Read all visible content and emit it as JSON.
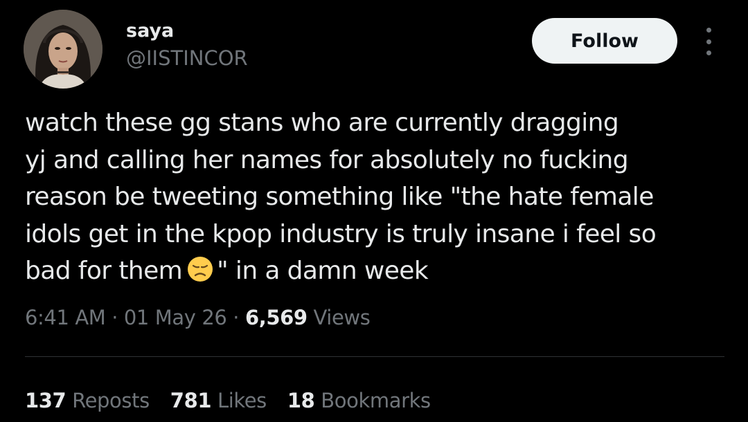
{
  "author": {
    "display_name": "saya",
    "handle": "@IISTINCOR",
    "avatar_icon": "profile-photo-avatar"
  },
  "actions": {
    "follow_label": "Follow",
    "more_icon": "more-options-icon"
  },
  "tweet": {
    "lines": [
      "watch these gg stans who are currently dragging",
      "yj and calling her names for absolutely no fucking",
      "reason be tweeting something like \"the hate female",
      "idols get in the kpop industry is truly insane i feel so"
    ],
    "last_line_before_emoji": "bad for them",
    "emoji": "disappointed-face-emoji",
    "last_line_after_emoji": "\" in a damn week"
  },
  "meta": {
    "time": "6:41 AM",
    "separator": " · ",
    "date": "01 May 26",
    "views_count": "6,569",
    "views_label": " Views"
  },
  "stats": {
    "reposts_count": "137",
    "reposts_label": " Reposts",
    "likes_count": "781",
    "likes_label": " Likes",
    "bookmarks_count": "18",
    "bookmarks_label": " Bookmarks"
  },
  "colors": {
    "background": "#000000",
    "primary_text": "#e7e9ea",
    "secondary_text": "#71767b",
    "follow_button_bg": "#eff3f4",
    "divider": "#2f3336"
  }
}
